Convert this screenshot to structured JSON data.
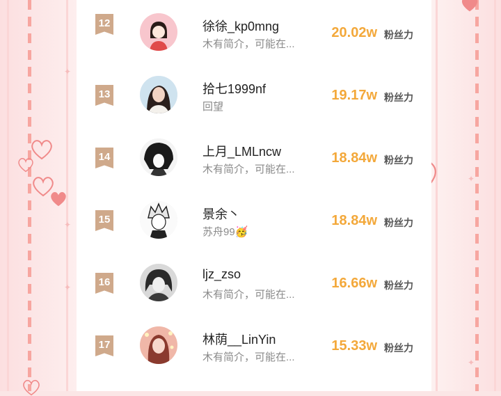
{
  "leaderboard": {
    "unit_label": "粉丝力",
    "rows": [
      {
        "rank": "12",
        "name": "徐徐_kp0mng",
        "bio": "木有简介，可能在...",
        "count": "20.02w"
      },
      {
        "rank": "13",
        "name": "拾七1999nf",
        "bio": "回望",
        "count": "19.17w"
      },
      {
        "rank": "14",
        "name": "上月_LMLncw",
        "bio": "木有简介，可能在...",
        "count": "18.84w"
      },
      {
        "rank": "15",
        "name": "景余丶",
        "bio": "苏舟99🥳",
        "count": "18.84w"
      },
      {
        "rank": "16",
        "name": "ljz_zso",
        "bio": "木有简介，可能在...",
        "count": "16.66w"
      },
      {
        "rank": "17",
        "name": "林荫__LinYin",
        "bio": "木有简介，可能在...",
        "count": "15.33w"
      }
    ]
  },
  "colors": {
    "rank_badge": "#cfa98b",
    "count": "#f3a83a",
    "frame_dash": "#f7a6a0",
    "heart": "#f08a8a"
  }
}
